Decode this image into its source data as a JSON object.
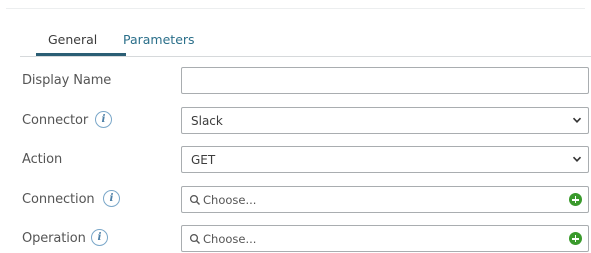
{
  "tabs": {
    "general": "General",
    "parameters": "Parameters"
  },
  "form": {
    "display_name": {
      "label": "Display Name",
      "value": ""
    },
    "connector": {
      "label": "Connector",
      "value": "Slack"
    },
    "action": {
      "label": "Action",
      "value": "GET"
    },
    "connection": {
      "label": "Connection",
      "placeholder": "Choose..."
    },
    "operation": {
      "label": "Operation",
      "placeholder": "Choose..."
    }
  },
  "info_glyph": "i",
  "colors": {
    "accent": "#2b5e74",
    "add_green": "#3a9a2c",
    "info_blue": "#4d7fa6"
  },
  "icons": [
    "info-icon",
    "chevron-down-icon",
    "search-icon",
    "add-icon"
  ]
}
